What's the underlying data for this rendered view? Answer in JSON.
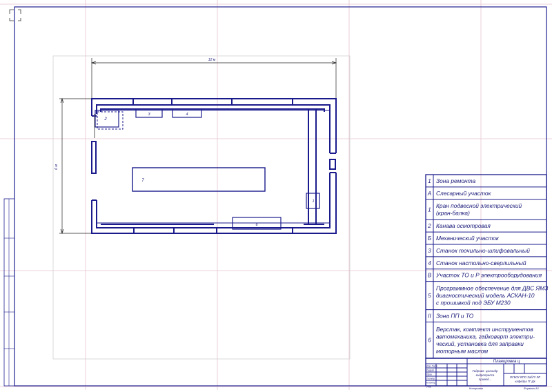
{
  "plan": {
    "dim_length": "12 м",
    "dim_width": "6 м",
    "equipment": {
      "e1": "1",
      "e2": "2",
      "e3": "3",
      "e4": "4",
      "e5": "5",
      "e6": "6",
      "e7": "7"
    }
  },
  "legend": [
    {
      "num": "1",
      "text": [
        "Зона ремонта"
      ]
    },
    {
      "num": "А",
      "text": [
        "Слесарный участок"
      ]
    },
    {
      "num": "1",
      "text": [
        "Кран подвесной электрический",
        "(кран-балка)"
      ]
    },
    {
      "num": "2",
      "text": [
        "Канава осмотровая"
      ]
    },
    {
      "num": "Б",
      "text": [
        "Механический участок"
      ]
    },
    {
      "num": "3",
      "text": [
        "Станок точильно-шлифовальный"
      ]
    },
    {
      "num": "4",
      "text": [
        "Станок настольно-сверлильный"
      ]
    },
    {
      "num": "В",
      "text": [
        "Участок ТО и Р электрооборудования"
      ]
    },
    {
      "num": "5",
      "text": [
        "Программное обеспечение для ДВС ЯМЗ",
        "диагностический модель АСКАН-10",
        "с прошивкой под ЭБУ М230"
      ]
    },
    {
      "num": "II",
      "text": [
        "Зона ПП и ТО"
      ]
    },
    {
      "num": "6",
      "text": [
        "Верстак, комплект инструментов",
        "автомеханика, гайковерт электри-",
        "ческий, установка для заправки",
        "моторным маслом"
      ]
    }
  ],
  "title_block": {
    "title": "Планировка ц",
    "name": [
      "Гидравл. цилиндр",
      "гидропресса",
      "привод..."
    ],
    "code": "ФГБОУ ВПО ЗабГУ РЛ",
    "group": "кафедра ГГ-Дк",
    "footer_left": "Копировал",
    "footer_right": "Формат А1"
  },
  "stamp_box": {
    "rows": [
      "Изм. Лист",
      "Разраб.",
      "Пров.",
      "Т.контр.",
      "Н.контр.",
      "Утв."
    ]
  },
  "colors": {
    "wall": "#1a1a8c",
    "frame": "#2a2a9a",
    "grid": "#e0b8c8",
    "legend": "#1a1a7a"
  }
}
